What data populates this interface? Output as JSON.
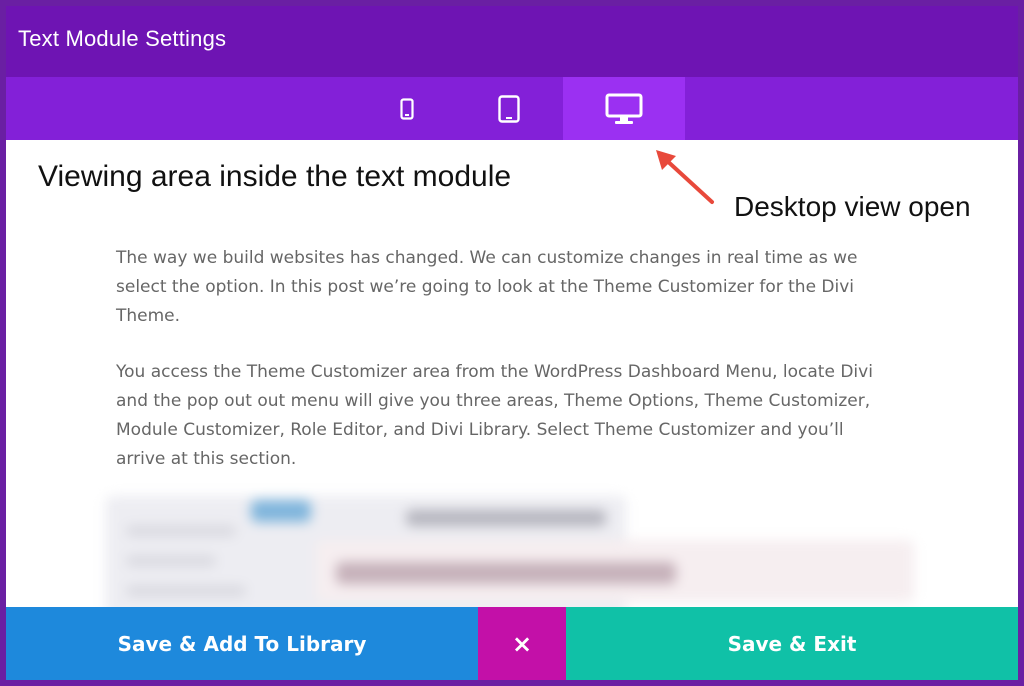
{
  "window": {
    "title": "Text Module Settings"
  },
  "device_tabs": [
    {
      "label": "phone",
      "icon": "phone-icon",
      "active": false
    },
    {
      "label": "tablet",
      "icon": "tablet-icon",
      "active": false
    },
    {
      "label": "desktop",
      "icon": "desktop-icon",
      "active": true
    }
  ],
  "annotations": {
    "viewing_area": "Viewing area inside the text module",
    "desktop_view": "Desktop view open",
    "arrow_color": "#e8493b"
  },
  "content": {
    "paragraph_1": "The way we build websites has changed. We can customize changes in real time as we select the option. In this post we’re going to look at the Theme Customizer for the Divi Theme.",
    "paragraph_2": "You access the Theme Customizer area from the WordPress Dashboard Menu, locate Divi and the pop out out menu will give you three areas, Theme Options, Theme Customizer, Module Customizer, Role Editor, and Divi Library.  Select Theme Customizer and you’ll arrive at this section."
  },
  "footer": {
    "save_library_label": "Save & Add To Library",
    "close_label": "×",
    "save_exit_label": "Save & Exit"
  },
  "colors": {
    "title_bar": "#6e14b3",
    "tab_bar": "#8320d8",
    "tab_active": "#9b30f2",
    "save_library": "#1e89dc",
    "close": "#c310a8",
    "save_exit": "#10c1a7"
  }
}
